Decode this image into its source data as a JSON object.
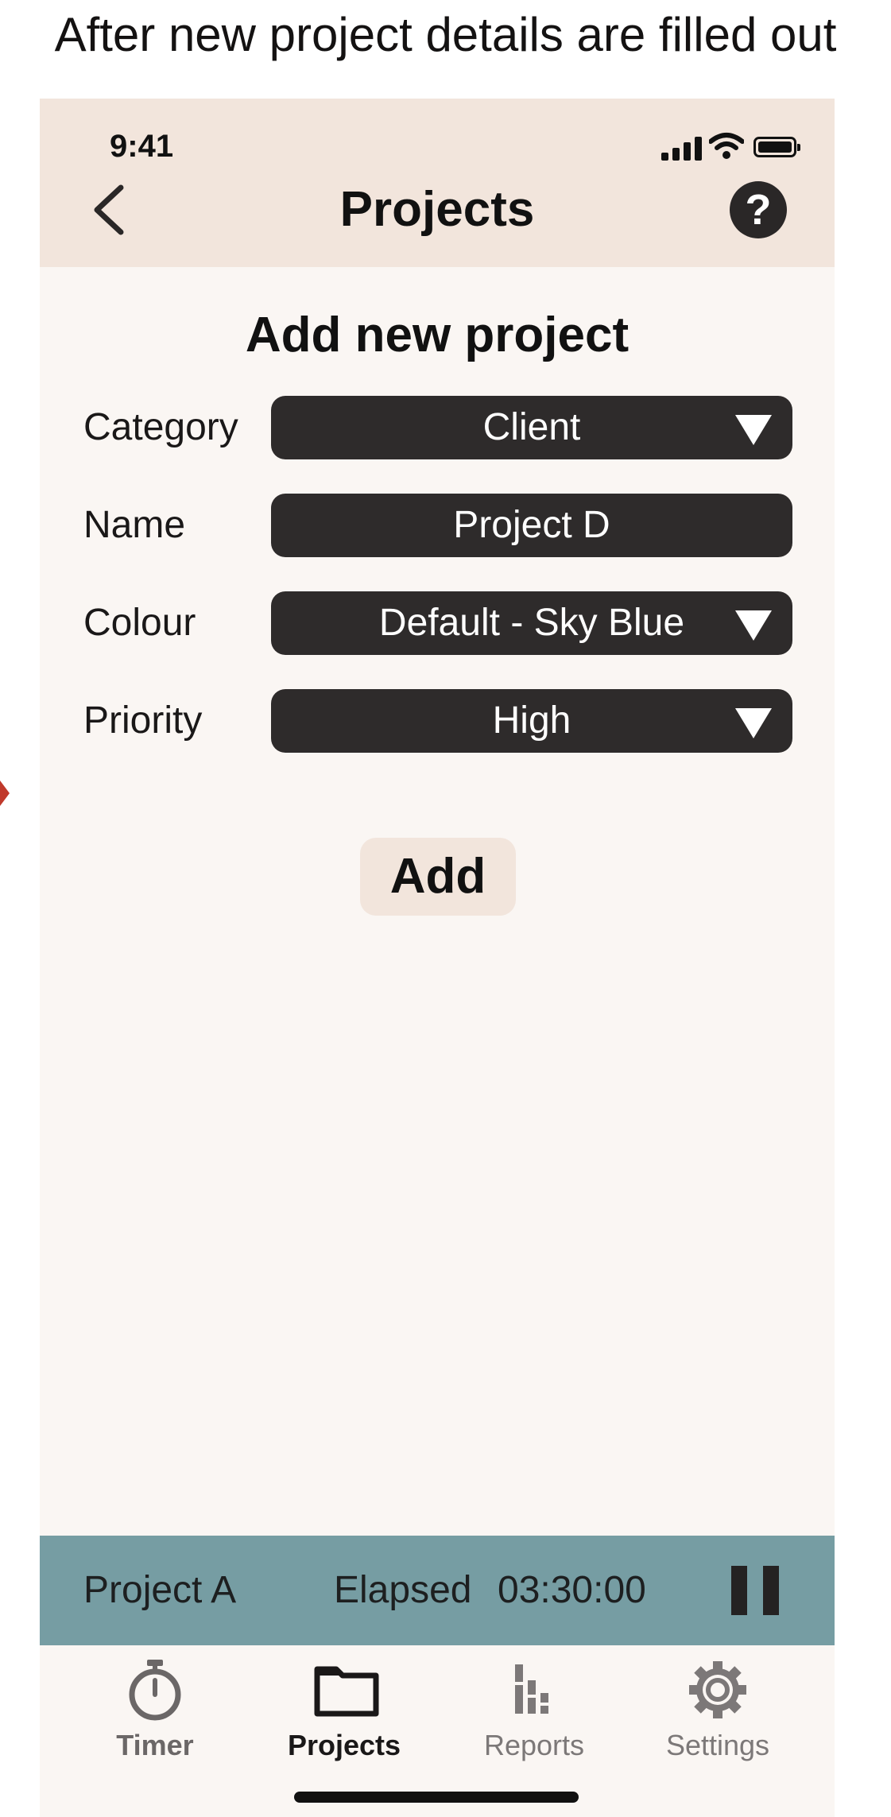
{
  "caption": "After new project details are filled out",
  "status_bar": {
    "time": "9:41"
  },
  "header": {
    "title": "Projects",
    "help_label": "?"
  },
  "form": {
    "title": "Add new project",
    "fields": [
      {
        "label": "Category",
        "value": "Client",
        "type": "dropdown"
      },
      {
        "label": "Name",
        "value": "Project D",
        "type": "text"
      },
      {
        "label": "Colour",
        "value": "Default - Sky Blue",
        "type": "dropdown"
      },
      {
        "label": "Priority",
        "value": "High",
        "type": "dropdown"
      }
    ],
    "submit_label": "Add"
  },
  "timer_bar": {
    "project": "Project A",
    "elapsed_label": "Elapsed",
    "elapsed_time": "03:30:00"
  },
  "tabs": [
    {
      "label": "Timer",
      "icon": "stopwatch-icon",
      "state": "inactive"
    },
    {
      "label": "Projects",
      "icon": "folder-icon",
      "state": "active"
    },
    {
      "label": "Reports",
      "icon": "bar-chart-icon",
      "state": "inactive"
    },
    {
      "label": "Settings",
      "icon": "gear-icon",
      "state": "inactive"
    }
  ],
  "colors": {
    "header_bg": "#f2e5dc",
    "page_bg": "#faf6f3",
    "field_bg": "#2e2b2b",
    "timer_bar_bg": "#769da3"
  }
}
